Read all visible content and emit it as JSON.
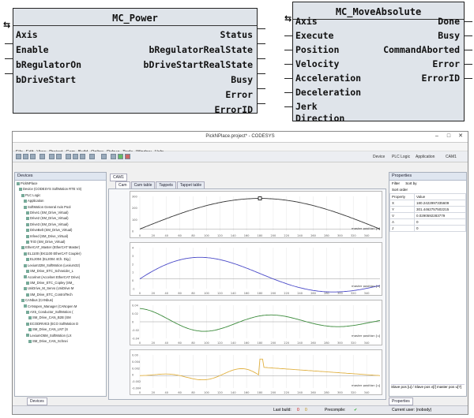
{
  "mc_power": {
    "title": "MC_Power",
    "inputs": [
      "Axis",
      "Enable",
      "bRegulatorOn",
      "bDriveStart"
    ],
    "outputs": [
      "Status",
      "bRegulatorRealState",
      "bDriveStartRealState",
      "Busy",
      "Error",
      "ErrorID"
    ]
  },
  "mc_moveabsolute": {
    "title": "MC_MoveAbsolute",
    "inputs": [
      "Axis",
      "Execute",
      "Position",
      "Velocity",
      "Acceleration",
      "Deceleration",
      "Jerk",
      "Direction"
    ],
    "outputs": [
      "Done",
      "Busy",
      "CommandAborted",
      "Error",
      "ErrorID"
    ]
  },
  "codesys": {
    "window_title": "PickNPlace.project* - CODESYS",
    "menu": [
      "File",
      "Edit",
      "View",
      "Project",
      "Cam",
      "Build",
      "Online",
      "Debug",
      "Tools",
      "Window",
      "Help"
    ],
    "toolbar_right": [
      "Device",
      "PLC Logic",
      "Application",
      "CAM1"
    ],
    "devices_panel_title": "Devices",
    "tree": [
      "PickNPlace",
      "Device (CODESYS SoftMotion RTE V3)",
      "PLC Logic",
      "Application",
      "SoftMotion General Axis Pool",
      "Drive1 (SM_Drive_Virtual)",
      "Drive2 (SM_Drive_Virtual)",
      "Drive3 (SM_Drive_Virtual)",
      "DriveBelt (SM_Drive_Virtual)",
      "Infeed (SM_Drive_Virtual)",
      "TriO (SM_Drive_Virtual)",
      "EtherCAT_Master (EtherCAT Master)",
      "EL1100 (EK1100 EtherCAT Coupler)",
      "EL2004 (EL2004 4Ch. Dig.)",
      "Lexium32M_SoftMotion (Lexium32)",
      "SM_Drive_ETC_Schneider_L",
      "Accelnet (Accelnet EtherCAT Drive)",
      "SM_Drive_ETC_Copley (SM_",
      "UniDrive_M_Servo (UniDrive M",
      "SM_Drive_ETC_ControlTech",
      "CANbus (CANbus)",
      "CANopen_Manager (CANopen M",
      "AX5_Conductor_SoftMotion (",
      "SM_Drive_CAN_B2B (SM",
      "ECODRIVE3 (ECO SoftMotion D",
      "SM_Drive_CAN_LNT (S",
      "LexiumO5M_SoftMotion (LX",
      "SM_Drive_CAN_Schnei"
    ],
    "devices_tab": "Devices",
    "editor_tab": "CAM1",
    "subtabs": [
      "Cam",
      "Cam table",
      "Tappets",
      "Tappet table"
    ],
    "plots": [
      {
        "label": "master position [u]",
        "yticks": [
          "300",
          "200",
          "100",
          "0"
        ]
      },
      {
        "label": "master position [u]",
        "yticks": [
          "4",
          "3",
          "2",
          "1",
          "0",
          "-1"
        ]
      },
      {
        "label": "master position [u]",
        "yticks": [
          "0.04",
          "0.02",
          "0",
          "-0.02",
          "-0.04"
        ]
      },
      {
        "label": "master position [u]",
        "yticks": [
          "0.00",
          "0.004",
          "0.002",
          "0",
          "-0.002",
          "-0.004"
        ]
      }
    ],
    "xticks": [
      "0",
      "20",
      "40",
      "60",
      "80",
      "100",
      "120",
      "140",
      "160",
      "180",
      "200",
      "220",
      "240",
      "260",
      "280",
      "300",
      "320",
      "340"
    ],
    "properties": {
      "title": "Properties",
      "filter": "Filter",
      "sort_by": "Sort by",
      "sort_order": "Sort order",
      "headers": [
        "Property",
        "Value"
      ],
      "rows": [
        [
          "X",
          "180.2422997335609"
        ],
        [
          "Y",
          "301.4462757502215"
        ],
        [
          "V",
          "0.0290592283779"
        ],
        [
          "A",
          "0"
        ],
        [
          "J",
          "0"
        ]
      ],
      "footer_text": "Slave pos [u] / Slave pos v[/] master pos u[?]",
      "tab": "Properties"
    },
    "status": {
      "last_build": "Last build:",
      "errors": "0",
      "warnings": "0",
      "precompile": "Precompile:",
      "user": "Current user: (nobody)"
    }
  }
}
